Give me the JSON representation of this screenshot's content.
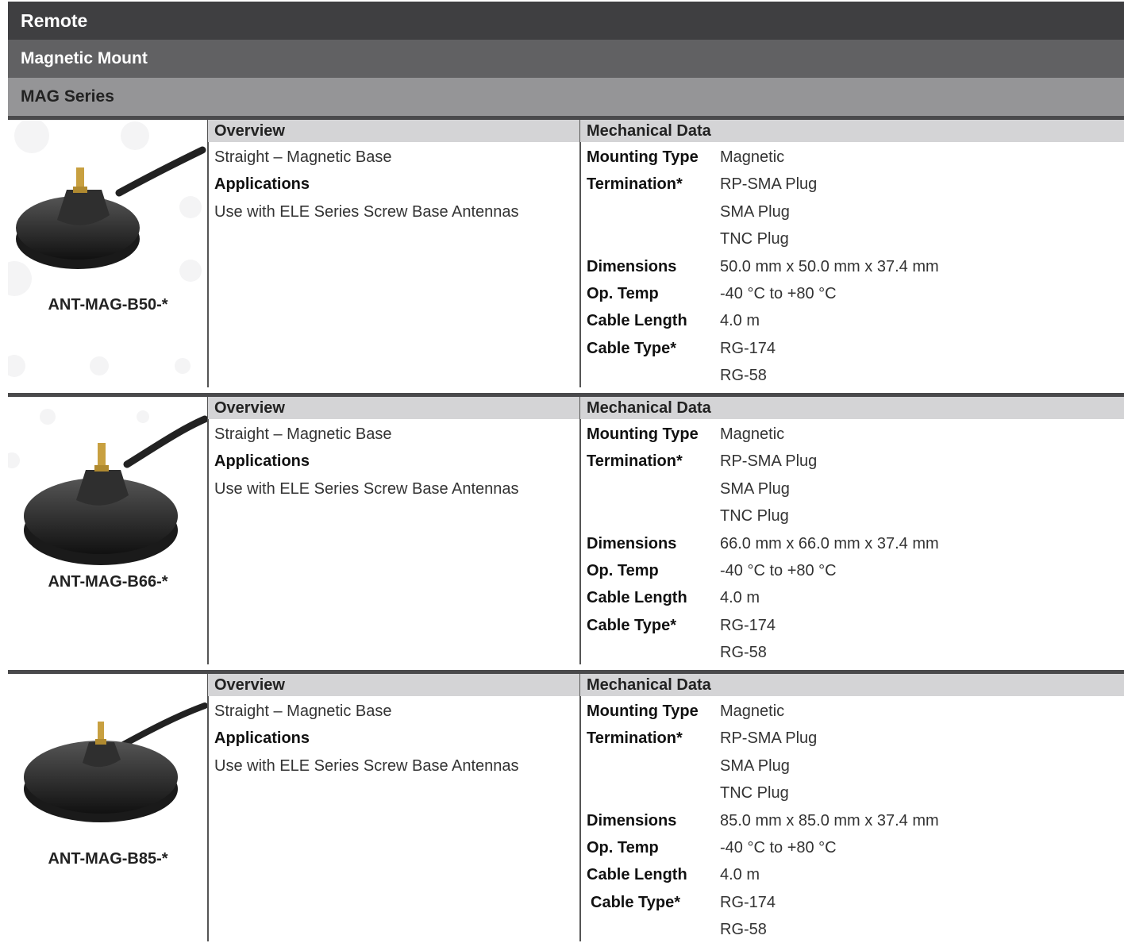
{
  "header": {
    "level1": "Remote",
    "level2": "Magnetic Mount",
    "level3": "MAG Series"
  },
  "labels": {
    "overview": "Overview",
    "mechanical": "Mechanical Data",
    "applications": "Applications",
    "mounting_type": "Mounting Type",
    "termination": "Termination*",
    "dimensions": "Dimensions",
    "op_temp": "Op. Temp",
    "cable_length": "Cable Length",
    "cable_type": "Cable Type*"
  },
  "products": [
    {
      "part_number": "ANT-MAG-B50-*",
      "overview": "Straight – Magnetic Base",
      "applications": "Use with ELE Series Screw Base Antennas",
      "mounting_type": "Magnetic",
      "termination": [
        "RP-SMA Plug",
        "SMA Plug",
        "TNC Plug"
      ],
      "dimensions": "50.0 mm x 50.0 mm x 37.4 mm",
      "op_temp": "-40 °C to +80 °C",
      "cable_length": "4.0 m",
      "cable_type": [
        "RG-174",
        "RG-58"
      ]
    },
    {
      "part_number": "ANT-MAG-B66-*",
      "overview": "Straight – Magnetic Base",
      "applications": "Use with ELE Series Screw Base Antennas",
      "mounting_type": "Magnetic",
      "termination": [
        "RP-SMA Plug",
        "SMA Plug",
        "TNC Plug"
      ],
      "dimensions": "66.0 mm x 66.0 mm x 37.4 mm",
      "op_temp": "-40 °C to +80 °C",
      "cable_length": "4.0 m",
      "cable_type": [
        "RG-174",
        "RG-58"
      ]
    },
    {
      "part_number": "ANT-MAG-B85-*",
      "overview": "Straight – Magnetic Base",
      "applications": "Use with ELE Series Screw Base Antennas",
      "mounting_type": "Magnetic",
      "termination": [
        "RP-SMA Plug",
        "SMA Plug",
        "TNC Plug"
      ],
      "dimensions": "85.0 mm x 85.0 mm x 37.4 mm",
      "op_temp": "-40 °C to +80 °C",
      "cable_length": "4.0 m",
      "cable_type": [
        "RG-174",
        "RG-58"
      ]
    }
  ],
  "icons": {
    "product_image": "magnetic-mount-antenna-base-icon"
  }
}
